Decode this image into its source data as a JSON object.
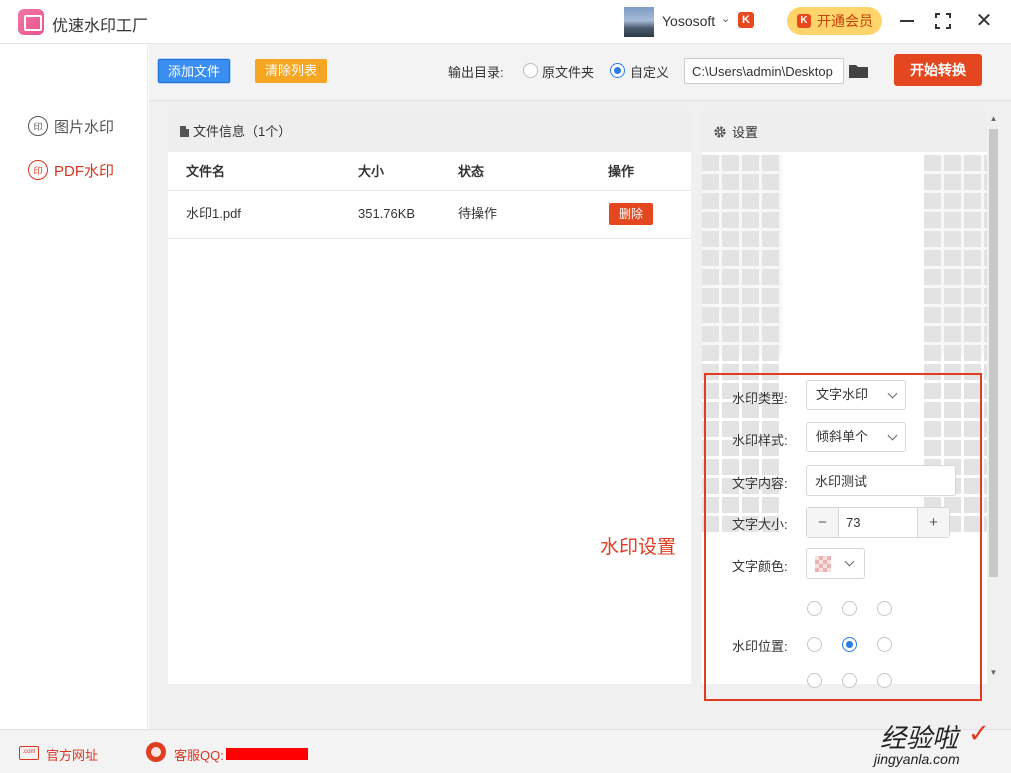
{
  "app": {
    "title": "优速水印工厂"
  },
  "user": {
    "name": "Yososoft",
    "badge": "K",
    "vip_label": "开通会员"
  },
  "sidebar": {
    "items": [
      {
        "label": "图片水印",
        "icon": "印"
      },
      {
        "label": "PDF水印",
        "icon": "印"
      }
    ]
  },
  "toolbar": {
    "add_file": "添加文件",
    "clear_list": "清除列表",
    "output_dir_label": "输出目录:",
    "radio_original": "原文件夹",
    "radio_custom": "自定义",
    "selected_output": "自定义",
    "path_value": "C:\\Users\\admin\\Desktop",
    "start": "开始转换"
  },
  "file_panel": {
    "header": "文件信息（1个）",
    "columns": [
      "文件名",
      "大小",
      "状态",
      "操作"
    ],
    "rows": [
      {
        "name": "水印1.pdf",
        "size": "351.76KB",
        "status": "待操作",
        "action": "删除"
      }
    ]
  },
  "annotation": "水印设置",
  "settings": {
    "header": "设置",
    "watermark_type_label": "水印类型:",
    "watermark_type": "文字水印",
    "watermark_style_label": "水印样式:",
    "watermark_style": "倾斜单个",
    "text_content_label": "文字内容:",
    "text_content": "水印测试",
    "text_size_label": "文字大小:",
    "text_size": "73",
    "text_color_label": "文字颜色:",
    "position_label": "水印位置:",
    "position_selected": "middle-center"
  },
  "footer": {
    "website": "官方网址",
    "support": "客服QQ:"
  },
  "watermark": {
    "cn": "经验啦",
    "en": "jingyanla.com"
  },
  "colors": {
    "accent": "#e4471f",
    "blue": "#3a8ef0",
    "orange": "#f5a623",
    "vip": "#ffd46a"
  }
}
